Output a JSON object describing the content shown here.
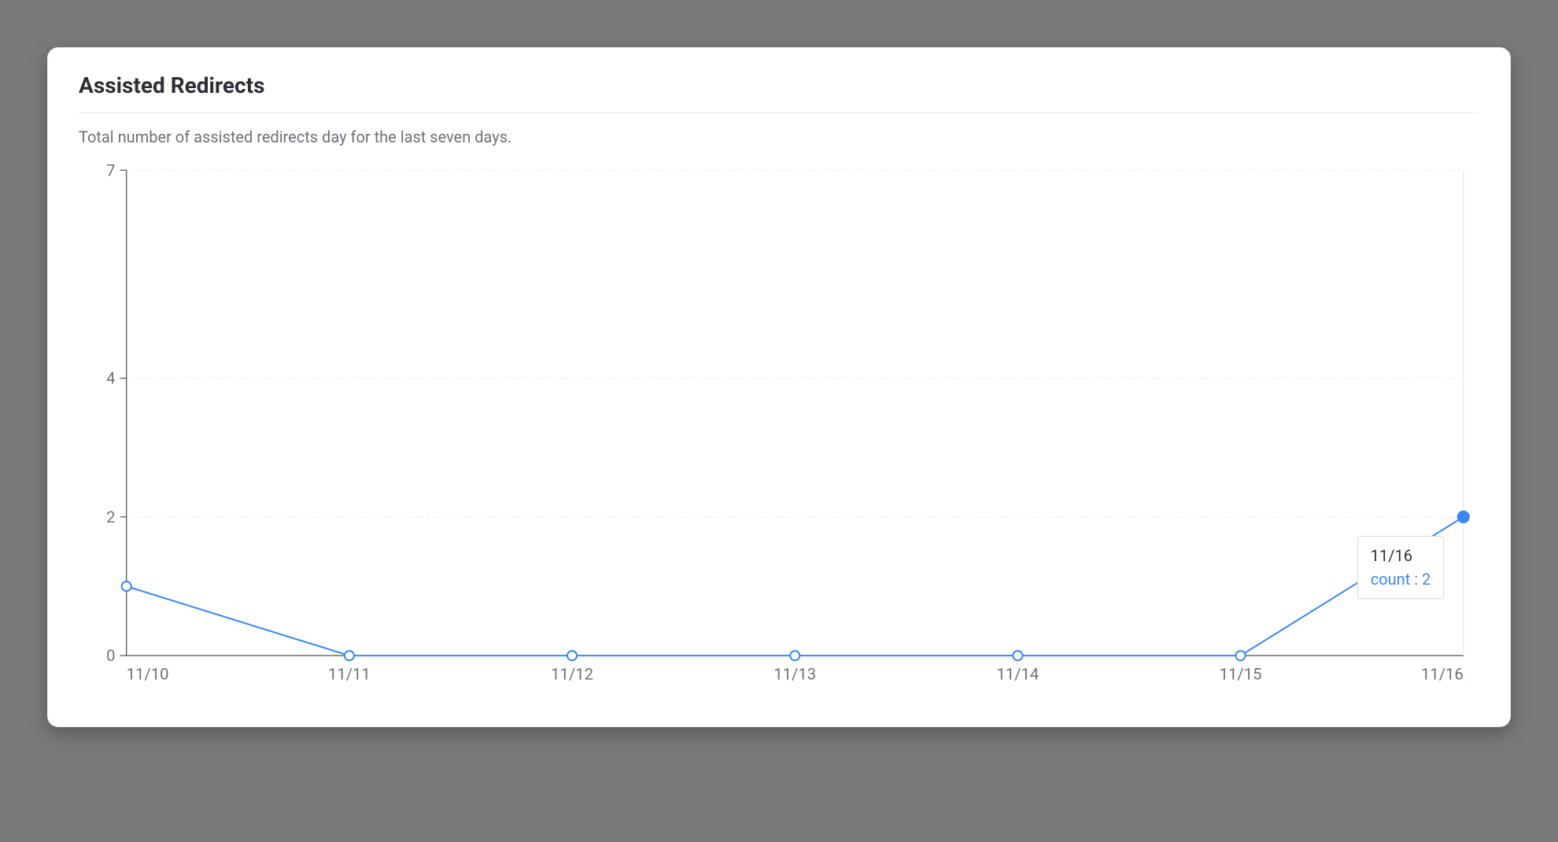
{
  "card": {
    "title": "Assisted Redirects",
    "subtitle": "Total number of assisted redirects day for the last seven days."
  },
  "chart_data": {
    "type": "line",
    "categories": [
      "11/10",
      "11/11",
      "11/12",
      "11/13",
      "11/14",
      "11/15",
      "11/16"
    ],
    "series": [
      {
        "name": "count",
        "values": [
          1,
          0,
          0,
          0,
          0,
          0,
          2
        ]
      }
    ],
    "ylim": [
      0,
      7
    ],
    "yticks": [
      0,
      2,
      4,
      7
    ],
    "xlabel": "",
    "ylabel": "",
    "title": "",
    "grid": true,
    "highlight_index": 6
  },
  "tooltip": {
    "label": "11/16",
    "metric_name": "count",
    "metric_value": "2",
    "separator": " : "
  },
  "colors": {
    "line": "#3a87f2",
    "grid": "#d9dcde",
    "axis": "#4a4d50",
    "text_muted": "#6b7177"
  }
}
